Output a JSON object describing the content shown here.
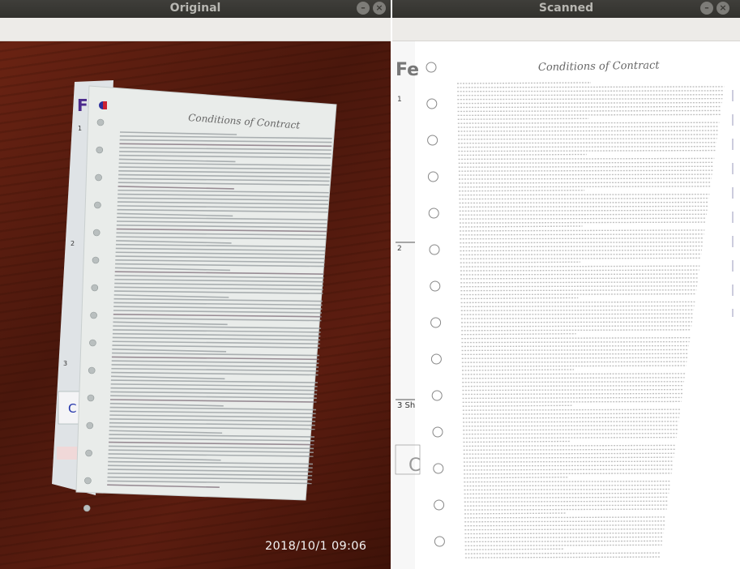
{
  "windows": {
    "left": {
      "title": "Original"
    },
    "right": {
      "title": "Scanned"
    }
  },
  "photo": {
    "timestamp": "2018/10/1  09:06"
  },
  "document": {
    "title": "Conditions of Contract",
    "side_logo": "Fe",
    "section_numbers": [
      "1",
      "2",
      "3"
    ],
    "scan_section_label": "3  Sh"
  },
  "colors": {
    "titlebar": "#35342f",
    "wood": "#5a1c0e",
    "paper": "#e9ecea",
    "brand_purple": "#4b2a8c"
  },
  "icons": {
    "minimize": "minimize-icon",
    "close": "close-icon"
  }
}
